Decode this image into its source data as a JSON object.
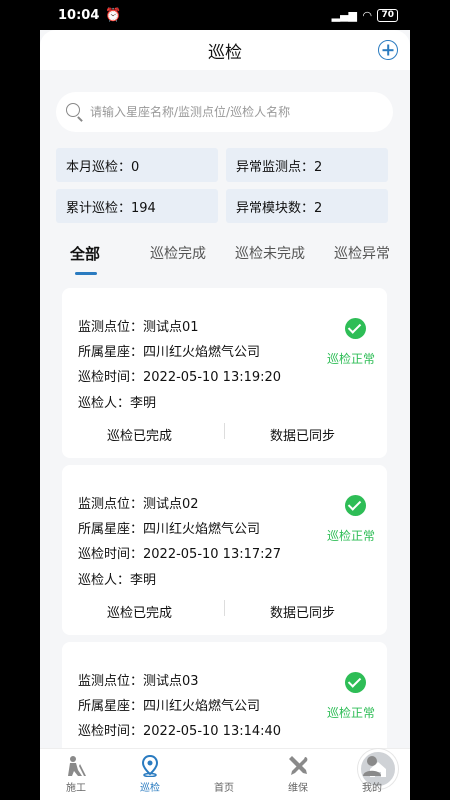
{
  "status_bar": {
    "time": "10:04",
    "battery": "70"
  },
  "header": {
    "title": "巡检"
  },
  "search": {
    "placeholder": "请输入星座名称/监测点位/巡检人名称"
  },
  "stats": [
    {
      "label": "本月巡检：0"
    },
    {
      "label": "异常监测点：2"
    },
    {
      "label": "累计巡检：194"
    },
    {
      "label": "异常模块数：2"
    }
  ],
  "tabs": [
    {
      "label": "全部"
    },
    {
      "label": "巡检完成"
    },
    {
      "label": "巡检未完成"
    },
    {
      "label": "巡检异常"
    }
  ],
  "records": [
    {
      "point": "监测点位：测试点01",
      "station": "所属星座：四川红火焰燃气公司",
      "time": "巡检时间：2022-05-10 13:19:20",
      "inspector": "巡检人：李明",
      "status": "巡检正常",
      "done": "巡检已完成",
      "sync": "数据已同步"
    },
    {
      "point": "监测点位：测试点02",
      "station": "所属星座：四川红火焰燃气公司",
      "time": "巡检时间：2022-05-10 13:17:27",
      "inspector": "巡检人：李明",
      "status": "巡检正常",
      "done": "巡检已完成",
      "sync": "数据已同步"
    },
    {
      "point": "监测点位：测试点03",
      "station": "所属星座：四川红火焰燃气公司",
      "time": "巡检时间：2022-05-10 13:14:40",
      "status": "巡检正常"
    }
  ],
  "tabbar": [
    {
      "label": "施工",
      "icon": "construction-icon"
    },
    {
      "label": "巡检",
      "icon": "location-pin-icon"
    },
    {
      "label": "首页",
      "icon": "home-icon"
    },
    {
      "label": "维保",
      "icon": "tools-icon"
    },
    {
      "label": "我的",
      "icon": "user-icon"
    }
  ],
  "colors": {
    "accent": "#2a7bc0",
    "ok": "#2ebd56"
  }
}
